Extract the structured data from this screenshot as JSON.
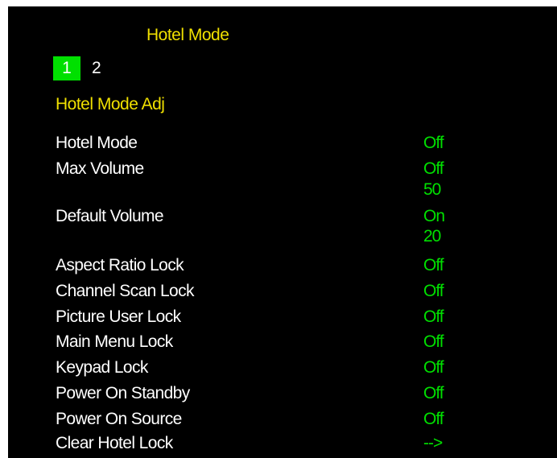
{
  "menu": {
    "title": "Hotel Mode",
    "pages": [
      "1",
      "2"
    ],
    "active_page": "1",
    "section_title": "Hotel Mode Adj"
  },
  "settings": {
    "hotel_mode": {
      "label": "Hotel Mode",
      "value": "Off"
    },
    "max_volume": {
      "label": "Max Volume",
      "value": "Off",
      "level": "50"
    },
    "default_volume": {
      "label": "Default Volume",
      "value": "On",
      "level": "20"
    },
    "aspect_ratio_lock": {
      "label": "Aspect Ratio Lock",
      "value": "Off"
    },
    "channel_scan_lock": {
      "label": "Channel Scan Lock",
      "value": "Off"
    },
    "picture_user_lock": {
      "label": "Picture User Lock",
      "value": "Off"
    },
    "main_menu_lock": {
      "label": "Main Menu Lock",
      "value": "Off"
    },
    "keypad_lock": {
      "label": "Keypad Lock",
      "value": "Off"
    },
    "power_on_standby": {
      "label": "Power On Standby",
      "value": "Off"
    },
    "power_on_source": {
      "label": "Power On Source",
      "value": "Off"
    },
    "clear_hotel_lock": {
      "label": "Clear Hotel Lock",
      "value": "-->"
    }
  },
  "colors": {
    "background": "#000000",
    "heading": "#f0e000",
    "label": "#ffffff",
    "value": "#00e000",
    "active_tab": "#00e000"
  }
}
